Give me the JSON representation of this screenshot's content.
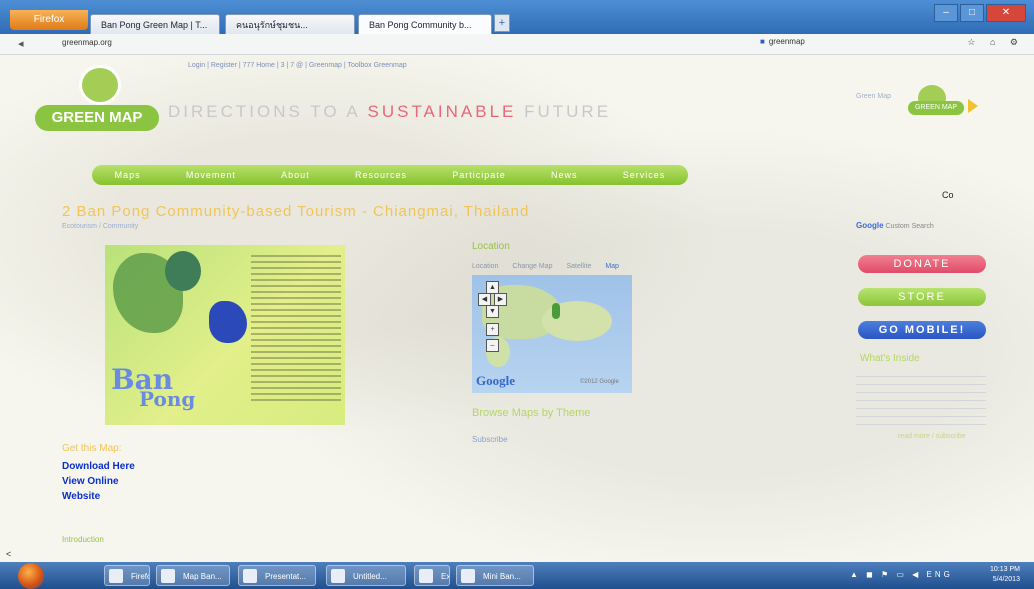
{
  "browser": {
    "firefox_label": "Firefox",
    "tabs": [
      {
        "label": "Ban Pong Green Map | T..."
      },
      {
        "label": "คนอนุรักษ์ชุมชน..."
      },
      {
        "label": "Ban Pong Community b..."
      }
    ],
    "new_tab": "+",
    "back": "◂",
    "url": "greenmap.org",
    "search_placeholder": "greenmap",
    "window_controls": {
      "minimize": "–",
      "maximize": "□",
      "close": "✕"
    },
    "nav_icons": "☆ ⌂ ⚙"
  },
  "site": {
    "top_links": "Login | Register | 777 Home | 3 | 7 @ | Greenmap | Toolbox Greenmap",
    "logo_text": "GREEN MAP",
    "tagline_pre": "DIRECTIONS TO A",
    "tagline_highlight": "SUSTAINABLE",
    "tagline_post": "FUTURE",
    "badge_small": "Green Map",
    "badge_text": "GREEN MAP",
    "menu": [
      "Maps",
      "Movement",
      "About",
      "Resources",
      "Participate",
      "News",
      "Services"
    ],
    "co_button": "Co"
  },
  "main": {
    "heading": "2 Ban Pong Community-based Tourism - Chiangmai, Thailand",
    "breadcrumb": "Ecotourism / Community",
    "map_title_line1": "Ban",
    "map_title_line2": "Pong",
    "get_map": "Get this Map:",
    "links": [
      "Download Here",
      "View Online",
      "Website"
    ],
    "introduction": "Introduction"
  },
  "location": {
    "title": "Location",
    "tabs": [
      "Location",
      "Change Map",
      "Satellite",
      "Map"
    ],
    "map_controls": {
      "up": "▲",
      "left": "◀",
      "right": "▶",
      "down": "▼",
      "zoom_in": "+",
      "zoom_out": "–"
    },
    "google_logo": "Google",
    "copyright": "©2012 Google",
    "browse": "Browse Maps by Theme",
    "subscribe": "Subscribe"
  },
  "sidebar": {
    "google_label": "Google",
    "search_label": "Custom Search",
    "donate": "DONATE",
    "store": "STORE",
    "mobile": "GO MOBILE!",
    "whats_new": "What's Inside",
    "more": "read more / subscribe"
  },
  "taskbar": {
    "tasks": [
      "Firefox",
      "Map Ban...",
      "Presentat...",
      "Untitled...",
      "Excel",
      "Mini Ban..."
    ],
    "tray": "▲ ◼ ⚑ ▭ ◀ ENG",
    "time": "10:13 PM",
    "date": "5/4/2013"
  },
  "scroll_left": "<"
}
